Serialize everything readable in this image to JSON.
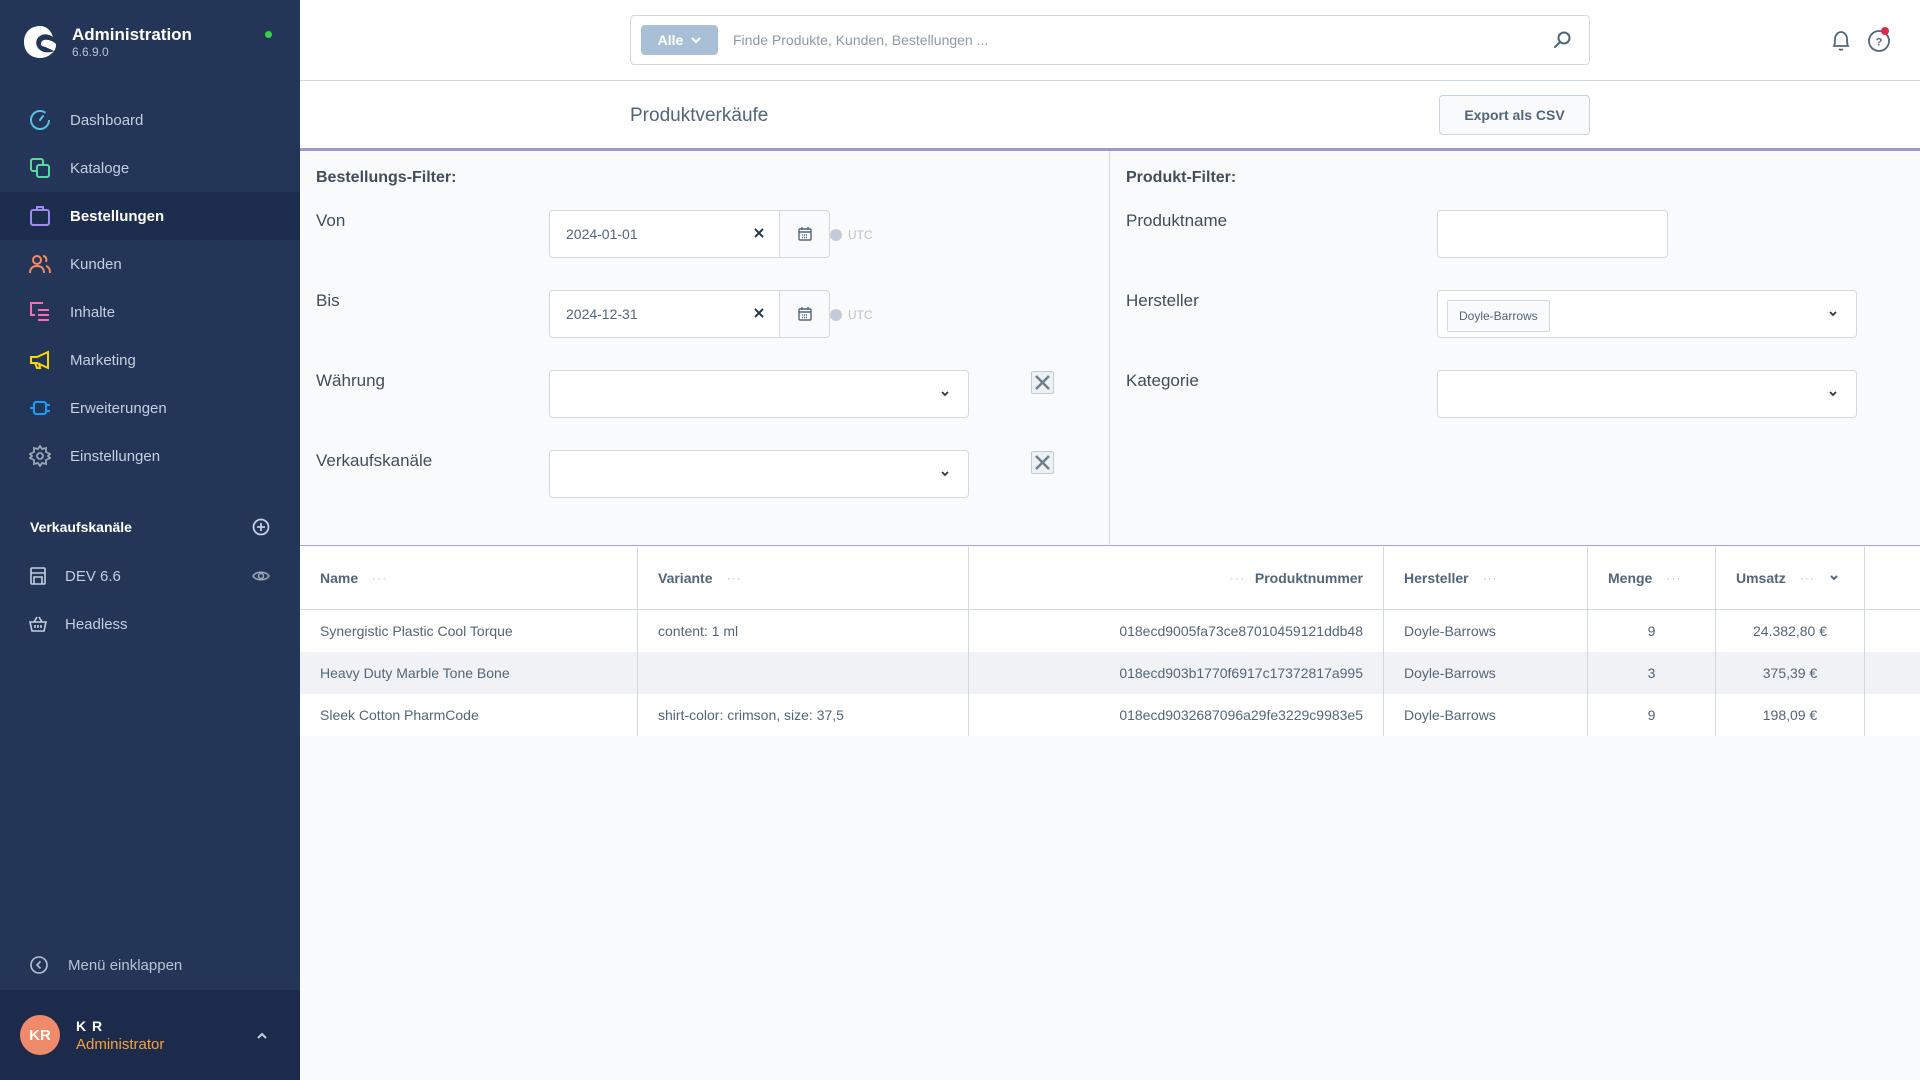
{
  "app": {
    "title": "Administration",
    "version": "6.6.9.0"
  },
  "sidebar": {
    "items": [
      {
        "label": "Dashboard",
        "icon": "dashboard-icon",
        "color": "#56c1e5"
      },
      {
        "label": "Kataloge",
        "icon": "catalog-icon",
        "color": "#57d9a3"
      },
      {
        "label": "Bestellungen",
        "icon": "shopping-bag-icon",
        "color": "#9e8cf0",
        "active": true
      },
      {
        "label": "Kunden",
        "icon": "users-icon",
        "color": "#f88962"
      },
      {
        "label": "Inhalte",
        "icon": "content-icon",
        "color": "#ff68b4"
      },
      {
        "label": "Marketing",
        "icon": "megaphone-icon",
        "color": "#ffd700"
      },
      {
        "label": "Erweiterungen",
        "icon": "plug-icon",
        "color": "#189eff"
      },
      {
        "label": "Einstellungen",
        "icon": "gear-icon",
        "color": "#9aa8b5"
      }
    ],
    "sales_channels_heading": "Verkaufskanäle",
    "sales_channels": [
      {
        "label": "DEV 6.6",
        "icon": "storefront-icon"
      },
      {
        "label": "Headless",
        "icon": "basket-icon"
      }
    ],
    "collapse_label": "Menü einklappen",
    "user": {
      "initials": "KR",
      "name": "K R",
      "role": "Administrator"
    }
  },
  "topbar": {
    "search_type": "Alle",
    "search_placeholder": "Finde Produkte, Kunden, Bestellungen ..."
  },
  "page": {
    "title": "Produktverkäufe",
    "export_label": "Export als CSV"
  },
  "order_filter": {
    "heading": "Bestellungs-Filter:",
    "from_label": "Von",
    "from_value": "2024-01-01",
    "to_label": "Bis",
    "to_value": "2024-12-31",
    "timezone": "UTC",
    "currency_label": "Währung",
    "currency_value": "",
    "saleschannels_label": "Verkaufskanäle",
    "saleschannels_value": ""
  },
  "product_filter": {
    "heading": "Produkt-Filter:",
    "name_label": "Produktname",
    "name_value": "",
    "manufacturer_label": "Hersteller",
    "manufacturer_tags": [
      "Doyle-Barrows"
    ],
    "category_label": "Kategorie",
    "category_value": ""
  },
  "table": {
    "columns": [
      "Name",
      "Variante",
      "Produktnummer",
      "Hersteller",
      "Menge",
      "Umsatz"
    ],
    "rows": [
      {
        "name": "Synergistic Plastic Cool Torque",
        "variant": "content: 1 ml",
        "number": "018ecd9005fa73ce87010459121ddb48",
        "manufacturer": "Doyle-Barrows",
        "quantity": "9",
        "revenue": "24.382,80 €"
      },
      {
        "name": "Heavy Duty Marble Tone Bone",
        "variant": "",
        "number": "018ecd903b1770f6917c17372817a995",
        "manufacturer": "Doyle-Barrows",
        "quantity": "3",
        "revenue": "375,39 €"
      },
      {
        "name": "Sleek Cotton PharmCode",
        "variant": "shirt-color: crimson, size: 37,5",
        "number": "018ecd9032687096a29fe3229c9983e5",
        "manufacturer": "Doyle-Barrows",
        "quantity": "9",
        "revenue": "198,09 €"
      }
    ]
  }
}
